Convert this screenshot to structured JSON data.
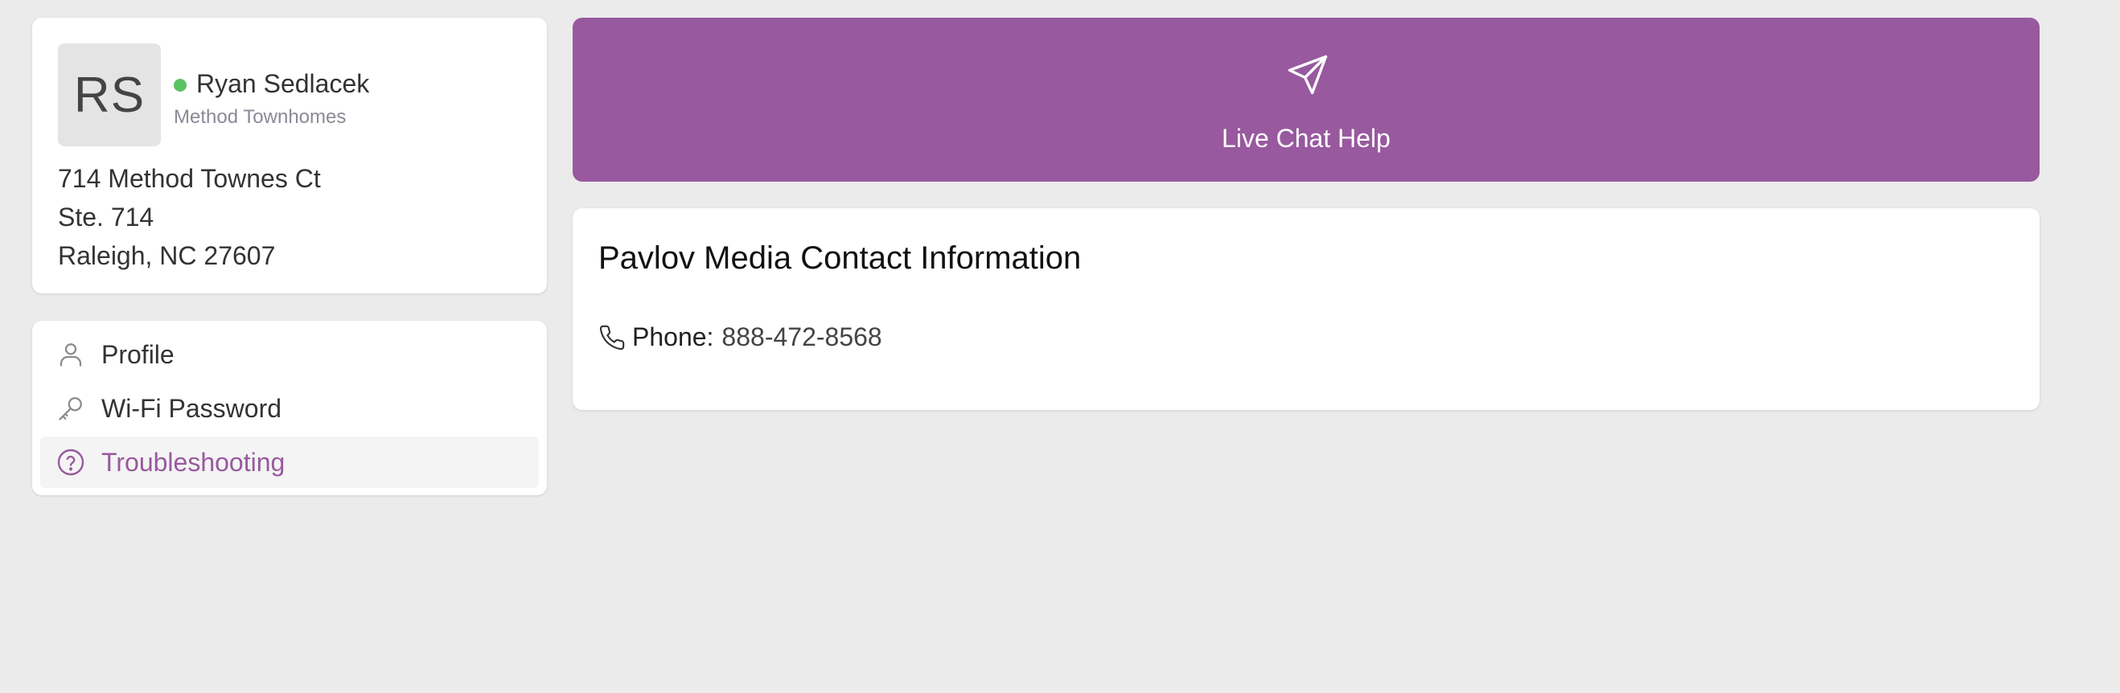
{
  "user": {
    "initials": "RS",
    "name": "Ryan Sedlacek",
    "company": "Method Townhomes",
    "status_color": "#5bc264",
    "address_lines": [
      "714 Method Townes Ct",
      "Ste. 714",
      "Raleigh, NC 27607"
    ]
  },
  "nav": {
    "items": [
      {
        "label": "Profile",
        "icon": "person-icon",
        "active": false
      },
      {
        "label": "Wi-Fi Password",
        "icon": "key-icon",
        "active": false
      },
      {
        "label": "Troubleshooting",
        "icon": "question-circle-icon",
        "active": true
      }
    ]
  },
  "chat": {
    "label": "Live Chat Help",
    "icon": "paper-plane-icon",
    "color": "#98599e"
  },
  "contact": {
    "title": "Pavlov Media Contact Information",
    "phone_label": "Phone:",
    "phone_value": "888-472-8568",
    "phone_icon": "phone-icon"
  },
  "theme": {
    "accent": "#98599e",
    "background": "#ebebeb"
  }
}
